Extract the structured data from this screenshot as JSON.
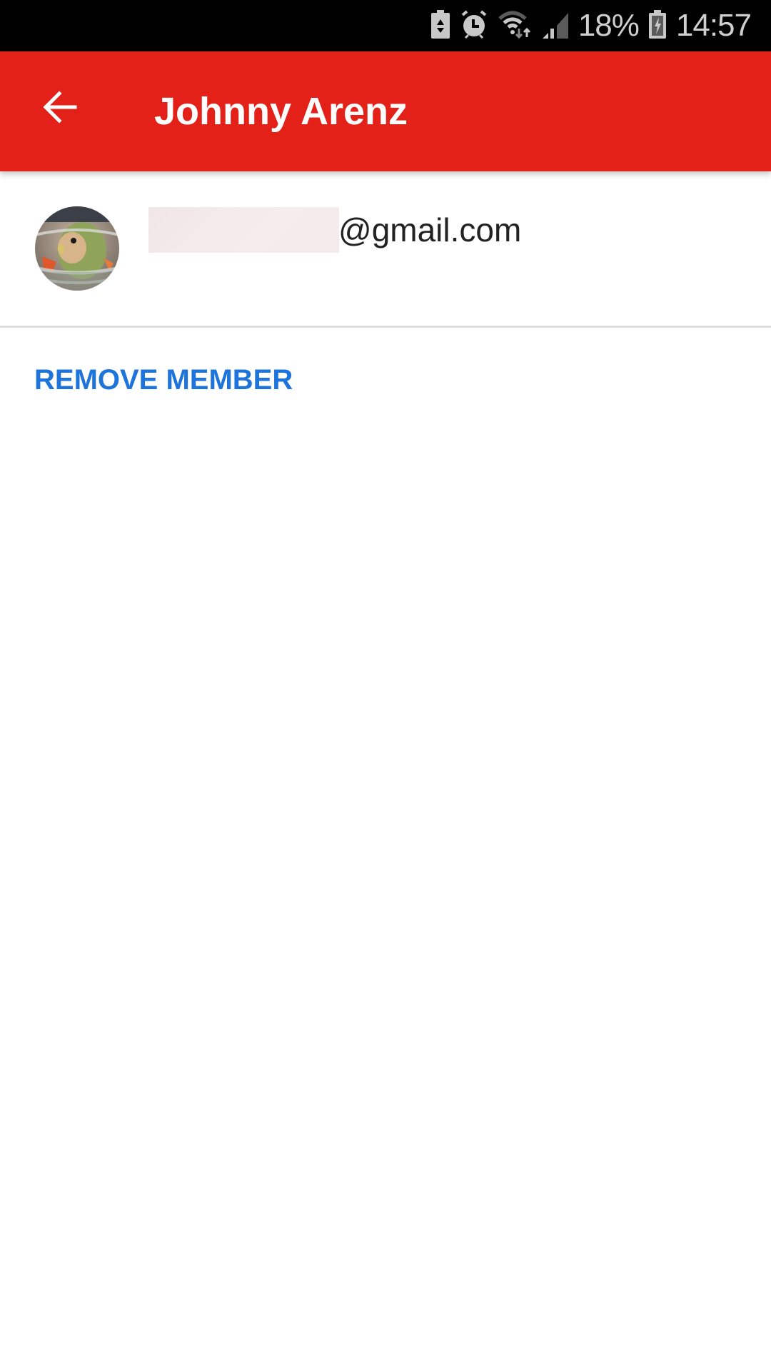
{
  "status_bar": {
    "icons": [
      "battery-saver-icon",
      "alarm-icon",
      "wifi-icon",
      "signal-icon",
      "battery-charging-icon"
    ],
    "battery_percent": "18%",
    "time": "14:57"
  },
  "app_bar": {
    "back_icon": "arrow-back-icon",
    "title": "Johnny Arenz"
  },
  "member": {
    "avatar_icon": "avatar-photo",
    "email_redacted": "",
    "email_domain": "@gmail.com"
  },
  "actions": {
    "remove_member_label": "REMOVE MEMBER"
  },
  "colors": {
    "app_bar": "#e32119",
    "accent": "#1f74db",
    "status_bar": "#000000",
    "divider": "#dedede"
  }
}
